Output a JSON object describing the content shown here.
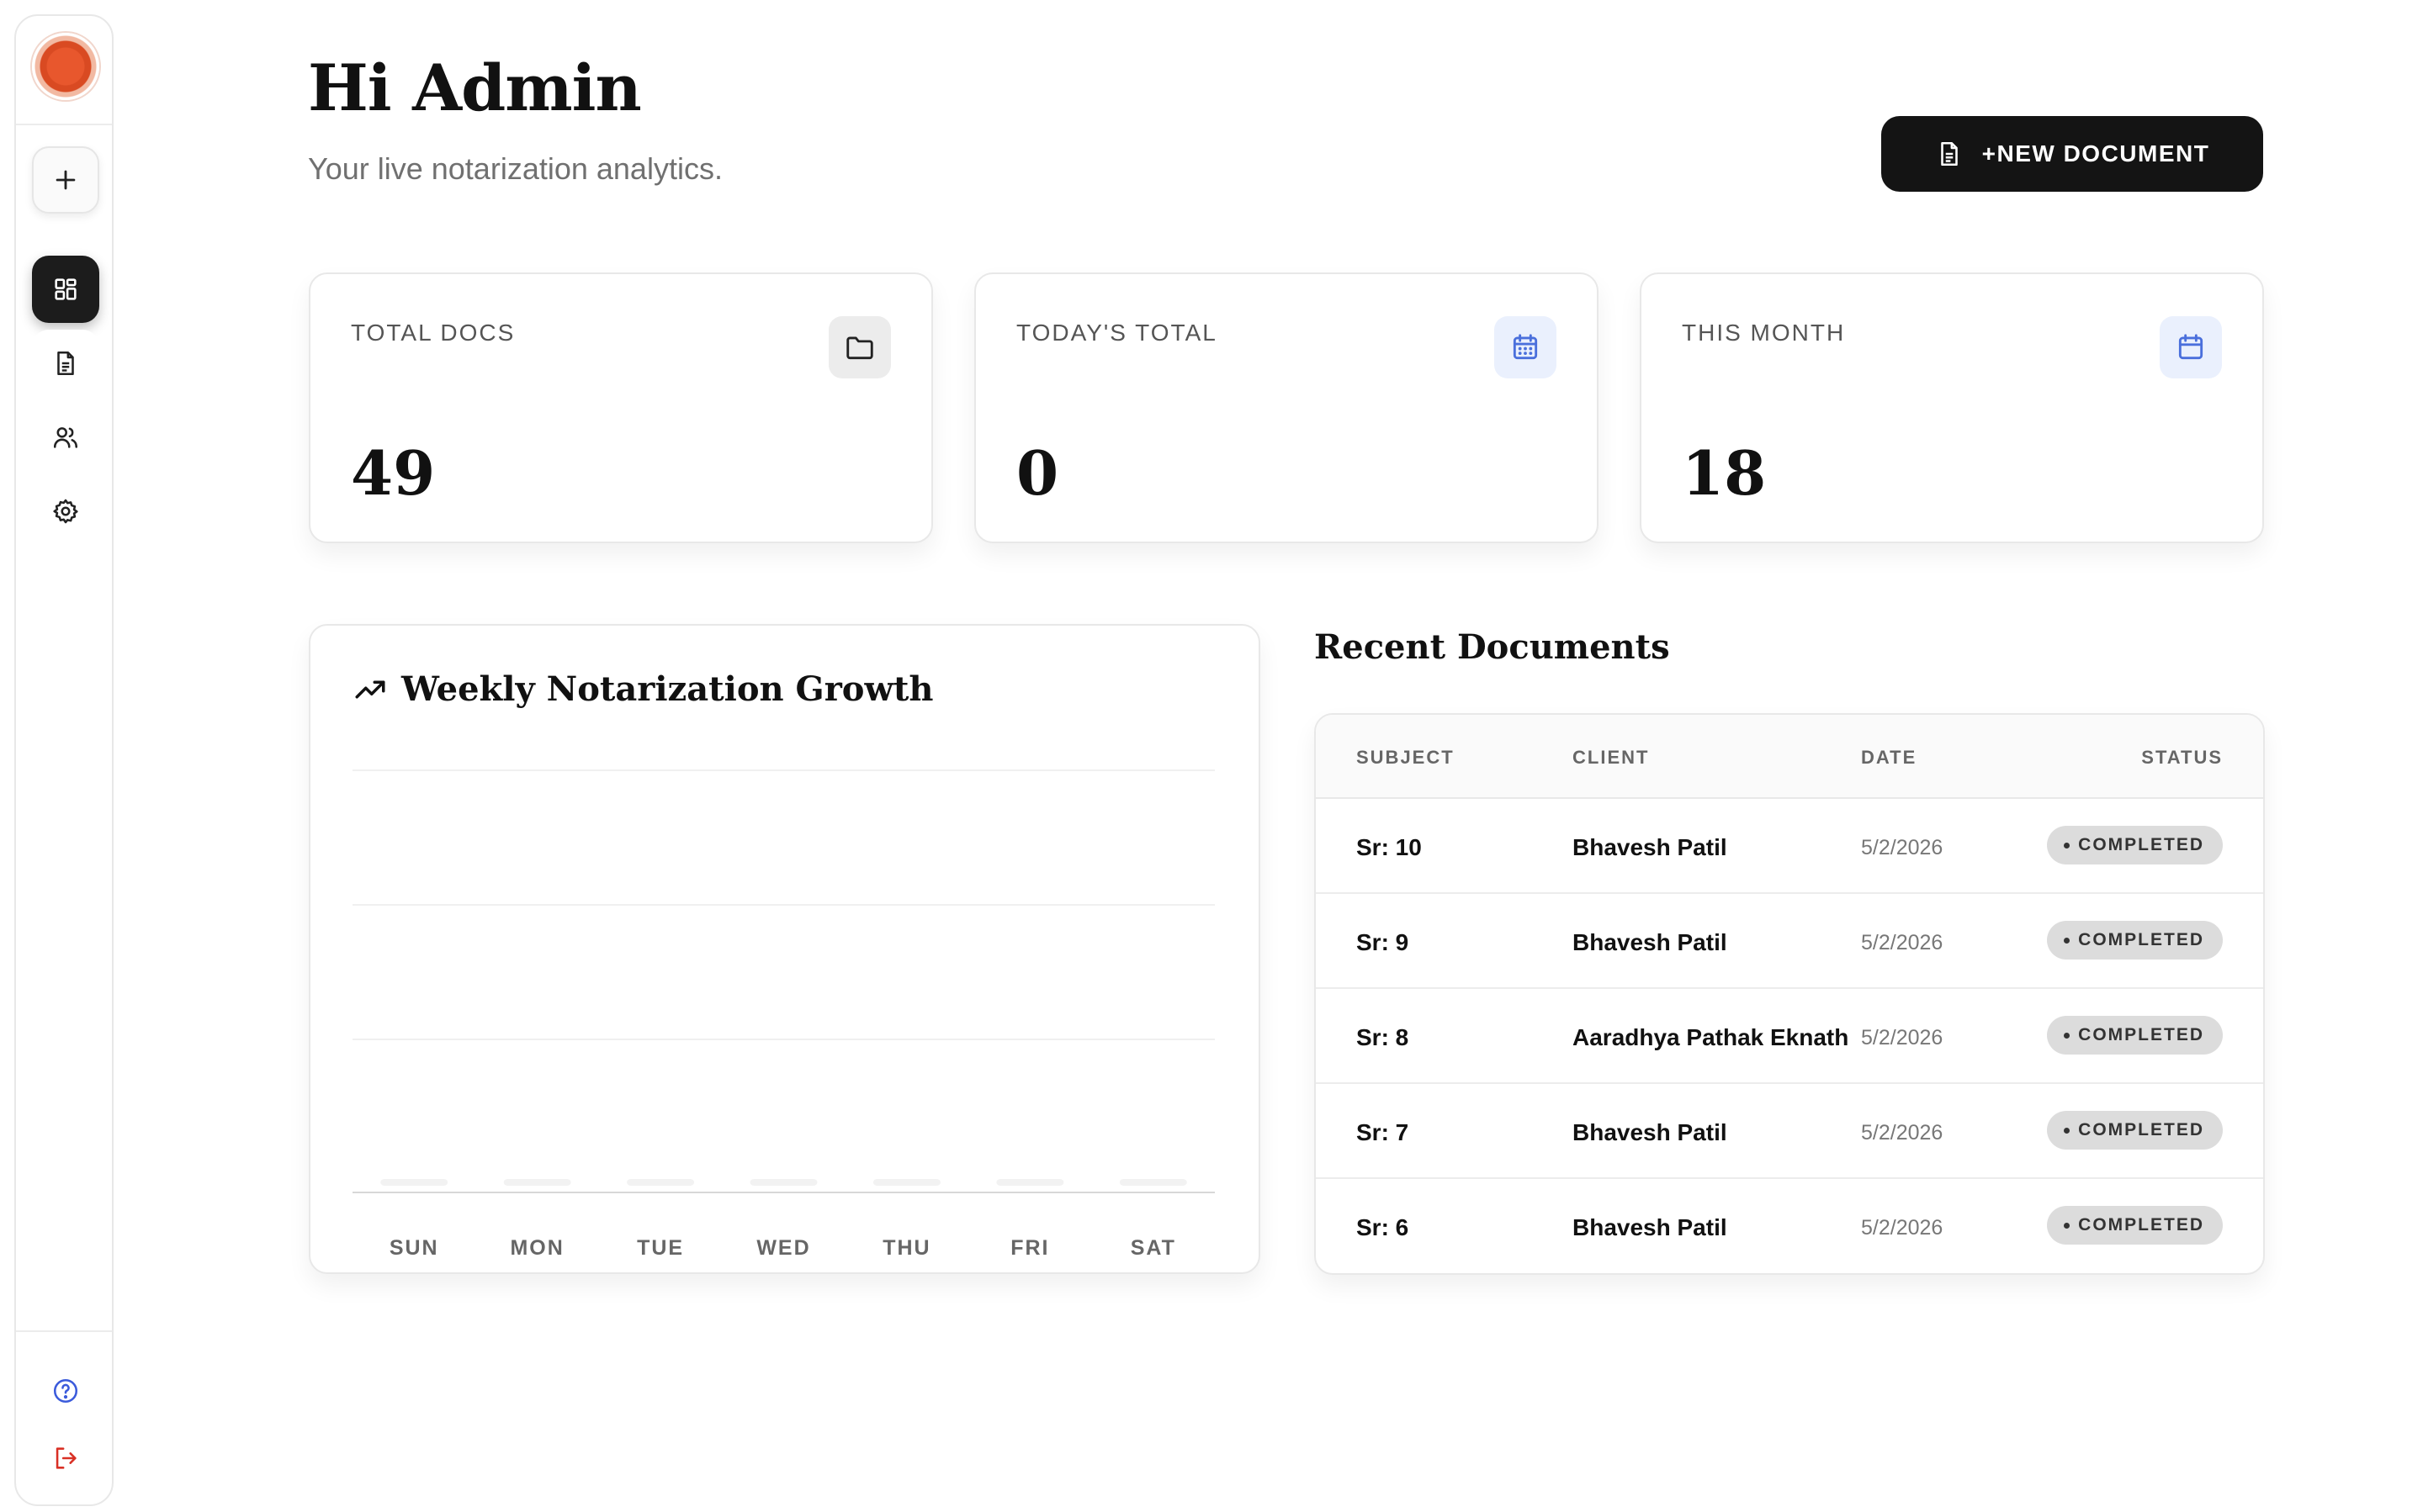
{
  "header": {
    "title": "Hi Admin",
    "subtitle": "Your live notarization analytics.",
    "new_document_label": "+NEW DOCUMENT"
  },
  "sidebar": {
    "items": [
      {
        "name": "add",
        "icon": "plus-icon"
      },
      {
        "name": "dashboard",
        "icon": "grid-icon",
        "active": true
      },
      {
        "name": "documents",
        "icon": "document-icon"
      },
      {
        "name": "users",
        "icon": "users-icon"
      },
      {
        "name": "settings",
        "icon": "gear-icon"
      },
      {
        "name": "help",
        "icon": "help-circle-icon"
      },
      {
        "name": "logout",
        "icon": "logout-icon"
      }
    ]
  },
  "stats": [
    {
      "label": "TOTAL DOCS",
      "value": "49",
      "icon": "folder-icon"
    },
    {
      "label": "TODAY'S TOTAL",
      "value": "0",
      "icon": "calendar-grid-icon"
    },
    {
      "label": "THIS MONTH",
      "value": "18",
      "icon": "calendar-icon"
    }
  ],
  "chart": {
    "title": "Weekly Notarization Growth",
    "icon": "trending-up-icon"
  },
  "chart_data": {
    "type": "bar",
    "title": "Weekly Notarization Growth",
    "categories": [
      "SUN",
      "MON",
      "TUE",
      "WED",
      "THU",
      "FRI",
      "SAT"
    ],
    "values": [
      0,
      0,
      0,
      0,
      0,
      0,
      0
    ],
    "grid": true,
    "xlabel": "",
    "ylabel": ""
  },
  "recent": {
    "title": "Recent Documents",
    "columns": [
      "SUBJECT",
      "CLIENT",
      "DATE",
      "STATUS"
    ],
    "rows": [
      {
        "subject": "Sr: 10",
        "client": "Bhavesh Patil",
        "date": "5/2/2026",
        "status": "COMPLETED"
      },
      {
        "subject": "Sr: 9",
        "client": "Bhavesh Patil",
        "date": "5/2/2026",
        "status": "COMPLETED"
      },
      {
        "subject": "Sr: 8",
        "client": "Aaradhya Pathak Eknath",
        "date": "5/2/2026",
        "status": "COMPLETED"
      },
      {
        "subject": "Sr: 7",
        "client": "Bhavesh Patil",
        "date": "5/2/2026",
        "status": "COMPLETED"
      },
      {
        "subject": "Sr: 6",
        "client": "Bhavesh Patil",
        "date": "5/2/2026",
        "status": "COMPLETED"
      }
    ]
  },
  "colors": {
    "accent": "#141414",
    "logo": "#e8572d",
    "calendar_icon": "#4a6fdc",
    "logout_icon": "#d93025",
    "help_icon": "#3b5bdb"
  }
}
